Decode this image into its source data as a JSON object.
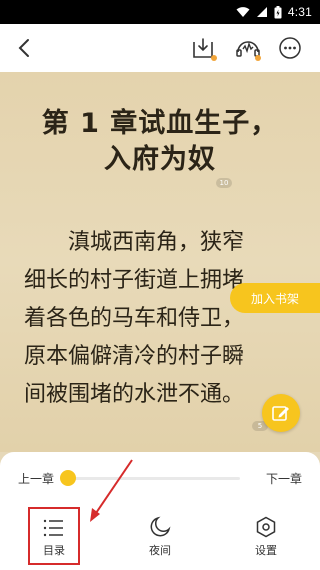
{
  "status": {
    "time": "4:31",
    "icons": [
      "wifi-icon",
      "signal-icon",
      "battery-icon"
    ]
  },
  "toolbar": {
    "icons": [
      "back-icon",
      "download-icon",
      "listen-icon",
      "more-icon"
    ],
    "accent_dot_color": "#f2a53a"
  },
  "reader": {
    "chapter_title_line1": "第 1 章试血生子，",
    "chapter_title_line2": "入府为奴",
    "title_page_marker": "10",
    "paragraph_lines": [
      "　　滇城西南角，狭窄",
      "细长的村子街道上拥堵",
      "着各色的马车和侍卫，",
      "原本偏僻清冷的村子瞬",
      "间被围堵的水泄不通。"
    ],
    "paragraph_marker": "5",
    "add_to_shelf": "加入书架",
    "accent_color": "#f7c51e"
  },
  "panel": {
    "prev_chapter": "上一章",
    "next_chapter": "下一章",
    "progress_fraction": 0.0,
    "nav": {
      "catalog": "目录",
      "night": "夜间",
      "settings": "设置"
    },
    "annotation_color": "#d62b2b"
  }
}
